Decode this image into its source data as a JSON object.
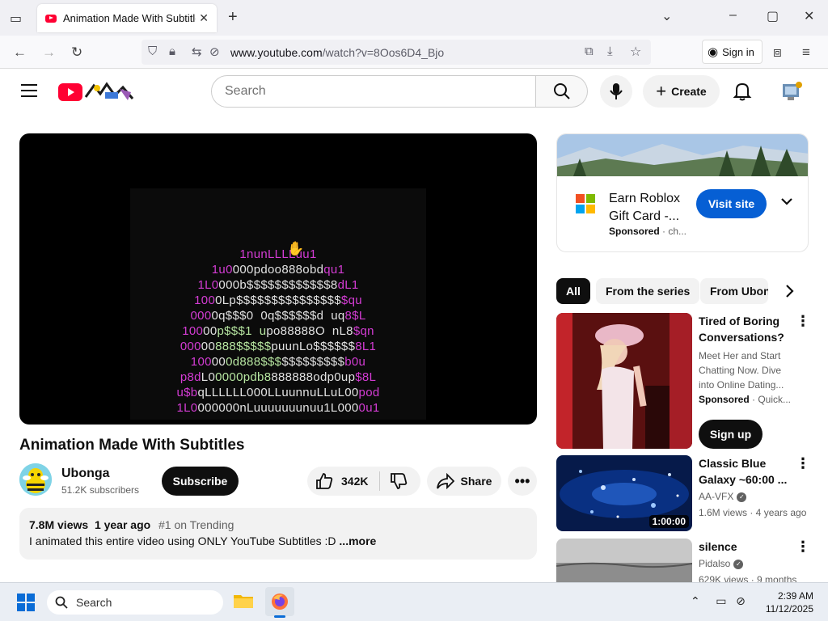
{
  "browser": {
    "tab_title": "Animation Made With Subtitles",
    "url_domain": "www.youtube.com",
    "url_path": "/watch?v=8Oos6D4_Bjo",
    "signin_label": "Sign in"
  },
  "header": {
    "search_placeholder": "Search",
    "create_label": "Create"
  },
  "video": {
    "ascii_lines": [
      "1nunLLLLuu1",
      "1u0000pdoo888obdqu1",
      "1L0000b$$$$$$$$$$$$8dL1",
      "1000Lp$$$$$$$$$$$$$$$$qu",
      "0000q$$$0  0q$$$$$$d  uq8$L",
      "10000p$$$1  upo88888O  nL8$qn",
      "00000888$$$$$puunLo$$$$$$8L1",
      "100000d888$$$$$$$$$$$$b0u",
      "p8dL00000pdb8888888odp0up$8L",
      "u$bqLLLLLL000LLuunnuLLuL00pod",
      "1L0000000nLuuuuuuunuu1L0000u1"
    ],
    "title": "Animation Made With Subtitles",
    "channel_name": "Ubonga",
    "subscribers": "51.2K subscribers",
    "subscribe_label": "Subscribe",
    "likes": "342K",
    "share_label": "Share",
    "views": "7.8M views",
    "age": "1 year ago",
    "trending": "#1 on Trending",
    "description": "I animated this entire video using ONLY YouTube Subtitles :D",
    "more_label": "...more"
  },
  "ad": {
    "title": "Earn Roblox Gift Card -...",
    "sponsored": "Sponsored",
    "domain": "ch...",
    "visit_label": "Visit site"
  },
  "chips": [
    "All",
    "From the series",
    "From Ubonga"
  ],
  "recommendations": [
    {
      "title": "Tired of Boring Conversations?",
      "desc": "Meet Her and Start Chatting Now. Dive into Online Dating...",
      "sponsored": "Sponsored",
      "advertiser": "Quick...",
      "cta": "Sign up"
    },
    {
      "title": "Classic Blue Galaxy ~60:00 ...",
      "channel": "AA-VFX",
      "stats": "1.6M views · 4 years ago",
      "duration": "1:00:00"
    },
    {
      "title": "silence",
      "channel": "Pidalso",
      "stats": "629K views · 9 months"
    }
  ],
  "taskbar": {
    "search_label": "Search",
    "time": "2:39 AM",
    "date": "11/12/2025"
  },
  "colors": {
    "yt_red": "#ff0033",
    "visit_blue": "#065fd4",
    "magenta": "#d43cd4",
    "green": "#b6e5a0"
  }
}
